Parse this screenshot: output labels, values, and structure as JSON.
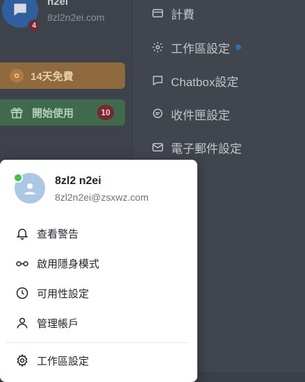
{
  "app": {
    "user_name": "n2ei",
    "user_email": "8zl2n2ei.com",
    "avatar_badge": "4",
    "trial_label": "14天免費",
    "start_label": "開始使用",
    "start_count": "10"
  },
  "settings_menu": {
    "items": [
      {
        "label": "計費",
        "icon": "credit-card-icon"
      },
      {
        "label": "工作區設定",
        "icon": "gear-icon"
      },
      {
        "label": "Chatbox設定",
        "icon": "chat-bubble-icon"
      },
      {
        "label": "收件匣設定",
        "icon": "chat-icon"
      },
      {
        "label": "電子郵件設定",
        "icon": "mail-icon"
      }
    ]
  },
  "profile_popup": {
    "name": "8zl2 n2ei",
    "email": "8zl2n2ei@zsxwz.com",
    "status": "online",
    "items": [
      {
        "label": "查看警告",
        "icon": "bell-icon"
      },
      {
        "label": "啟用隱身模式",
        "icon": "glasses-icon"
      },
      {
        "label": "可用性設定",
        "icon": "clock-icon"
      },
      {
        "label": "管理帳戶",
        "icon": "user-icon"
      },
      {
        "label": "工作區設定",
        "icon": "gear-icon"
      }
    ]
  },
  "colors": {
    "overlay_bg": "#3a3f48",
    "online": "#3cc64a",
    "badge": "#7a2630",
    "trial": "#8f6a3f",
    "start": "#3f6a4d",
    "accent_dot": "#2f6fb0"
  }
}
